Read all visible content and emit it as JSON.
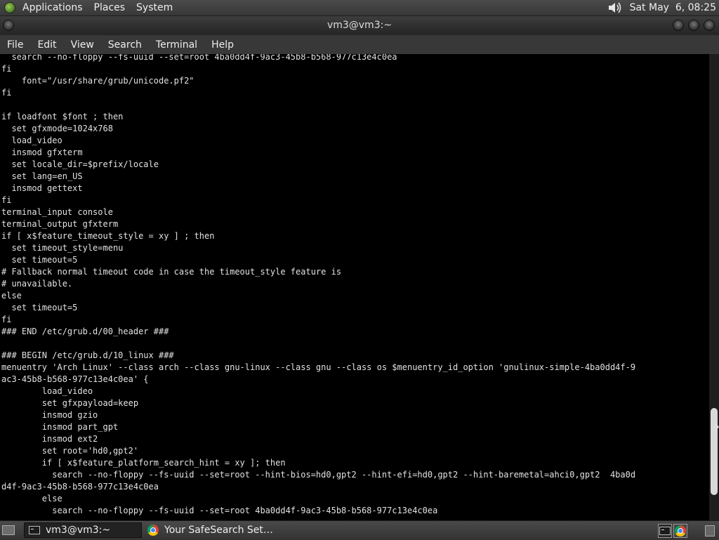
{
  "top_panel": {
    "menus": [
      "Applications",
      "Places",
      "System"
    ],
    "clock": "Sat May  6, 08:25"
  },
  "window": {
    "title": "vm3@vm3:~"
  },
  "menubar": [
    "File",
    "Edit",
    "View",
    "Search",
    "Terminal",
    "Help"
  ],
  "terminal": {
    "lines": [
      "  search --no-floppy --fs-uuid --set=root 4ba0dd4f-9ac3-45b8-b568-977c13e4c0ea",
      "fi",
      "    font=\"/usr/share/grub/unicode.pf2\"",
      "fi",
      "",
      "if loadfont $font ; then",
      "  set gfxmode=1024x768",
      "  load_video",
      "  insmod gfxterm",
      "  set locale_dir=$prefix/locale",
      "  set lang=en_US",
      "  insmod gettext",
      "fi",
      "terminal_input console",
      "terminal_output gfxterm",
      "if [ x$feature_timeout_style = xy ] ; then",
      "  set timeout_style=menu",
      "  set timeout=5",
      "# Fallback normal timeout code in case the timeout_style feature is",
      "# unavailable.",
      "else",
      "  set timeout=5",
      "fi",
      "### END /etc/grub.d/00_header ###",
      "",
      "### BEGIN /etc/grub.d/10_linux ###",
      "menuentry 'Arch Linux' --class arch --class gnu-linux --class gnu --class os $menuentry_id_option 'gnulinux-simple-4ba0dd4f-9",
      "ac3-45b8-b568-977c13e4c0ea' {",
      "        load_video",
      "        set gfxpayload=keep",
      "        insmod gzio",
      "        insmod part_gpt",
      "        insmod ext2",
      "        set root='hd0,gpt2'",
      "        if [ x$feature_platform_search_hint = xy ]; then",
      "          search --no-floppy --fs-uuid --set=root --hint-bios=hd0,gpt2 --hint-efi=hd0,gpt2 --hint-baremetal=ahci0,gpt2  4ba0d",
      "d4f-9ac3-45b8-b568-977c13e4c0ea",
      "        else",
      "          search --no-floppy --fs-uuid --set=root 4ba0dd4f-9ac3-45b8-b568-977c13e4c0ea"
    ]
  },
  "taskbar": {
    "tasks": [
      "vm3@vm3:~",
      "Your SafeSearch Set…"
    ]
  }
}
